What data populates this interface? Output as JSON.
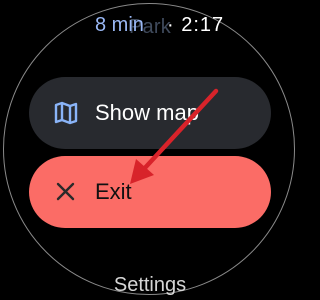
{
  "status": {
    "ghost_title": "Park",
    "duration": "8 min",
    "separator": "·",
    "time": "2:17"
  },
  "menu": {
    "items": [
      {
        "label": "Show map",
        "icon": "map-icon"
      },
      {
        "label": "Exit",
        "icon": "close-icon"
      }
    ]
  },
  "footer": {
    "settings_label": "Settings"
  },
  "annotation": {
    "arrow_color": "#d8232a",
    "points_to": "Exit"
  },
  "colors": {
    "background": "#000000",
    "chip_dark": "#282a2f",
    "chip_exit": "#fb6c66",
    "accent_blue": "#9ab8f5",
    "map_icon_blue": "#8ab4f8"
  }
}
